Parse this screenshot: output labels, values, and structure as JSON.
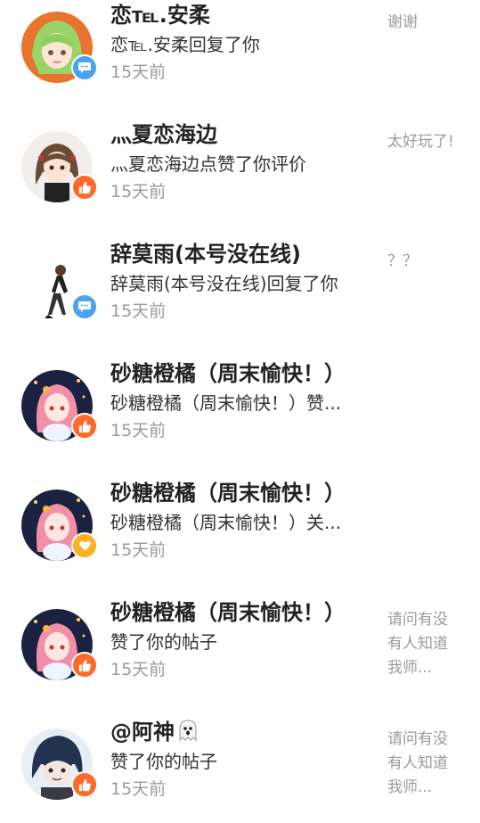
{
  "notifications": [
    {
      "name": "恋℡.安柔",
      "action": "恋℡.安柔回复了你",
      "time": "15天前",
      "preview": "谢谢",
      "badge": "comment-icon"
    },
    {
      "name": "灬夏恋海边",
      "action": "灬夏恋海边点赞了你评价",
      "time": "15天前",
      "preview": "太好玩了!",
      "badge": "thumbs-up-icon"
    },
    {
      "name": "辞莫雨(本号没在线)",
      "action": "辞莫雨(本号没在线)回复了你",
      "time": "15天前",
      "preview": "？？",
      "badge": "comment-icon"
    },
    {
      "name": "砂糖橙橘（周末愉快！）",
      "action": "砂糖橙橘（周末愉快！）赞...",
      "time": "15天前",
      "preview": "",
      "badge": "thumbs-up-icon"
    },
    {
      "name": "砂糖橙橘（周末愉快！）",
      "action": "砂糖橙橘（周末愉快！）关...",
      "time": "15天前",
      "preview": "",
      "badge": "heart-icon"
    },
    {
      "name": "砂糖橙橘（周末愉快！）",
      "action": "赞了你的帖子",
      "time": "15天前",
      "preview": "请问有没有人知道我师...",
      "badge": "thumbs-up-icon"
    },
    {
      "name": "@阿神",
      "action": "赞了你的帖子",
      "time": "15天前",
      "preview": "请问有没有人知道我师...",
      "badge": "thumbs-up-icon"
    }
  ],
  "colors": {
    "comment_badge": "#4aa3f0",
    "like_badge": "#ff6a2a",
    "name_text": "#222222",
    "secondary_text": "#9a9a9a"
  }
}
